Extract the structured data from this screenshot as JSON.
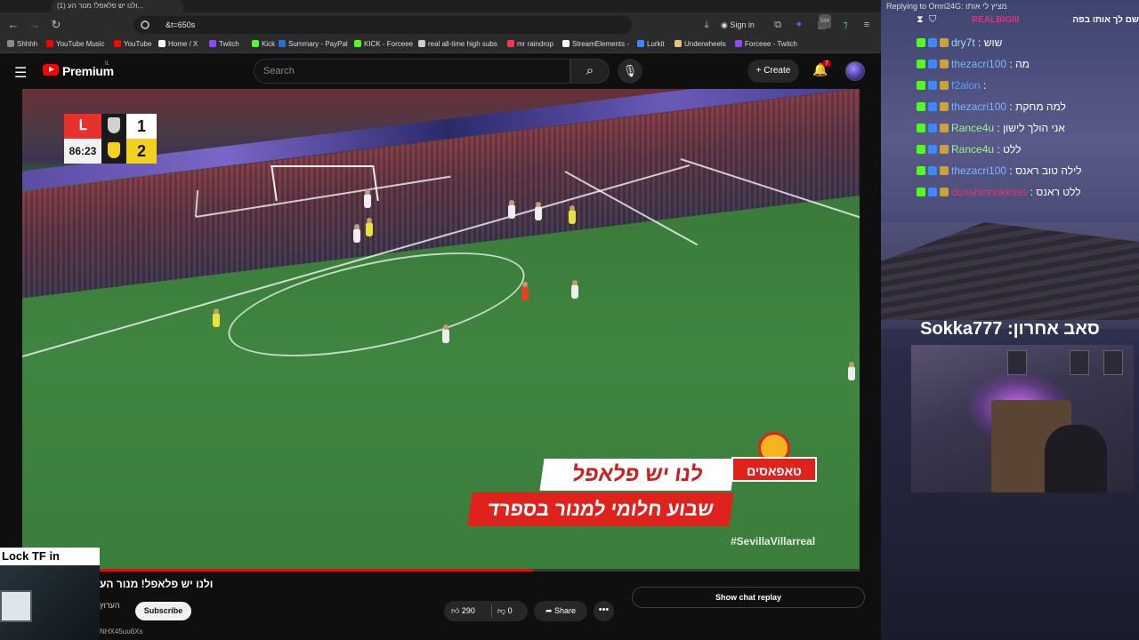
{
  "browser": {
    "tab_title": "(1) ולנו יש פלאפל! מנור הע...",
    "url": "&t=650s",
    "sign_in": "Sign in",
    "extension_count": "584",
    "bookmarks": [
      {
        "label": "Shhhh",
        "color": "#888888"
      },
      {
        "label": "YouTube Music",
        "color": "#ff0000"
      },
      {
        "label": "YouTube",
        "color": "#ff0000"
      },
      {
        "label": "Home / X",
        "color": "#ffffff"
      },
      {
        "label": "Twitch",
        "color": "#9146ff"
      },
      {
        "label": "Kick",
        "color": "#53fc18"
      },
      {
        "label": "Summary - PayPal",
        "color": "#1f6fd6"
      },
      {
        "label": "KICK - Forceee",
        "color": "#53fc18"
      },
      {
        "label": "real all-time high subs",
        "color": "#cccccc"
      },
      {
        "label": "mr raindrop",
        "color": "#ff3355"
      },
      {
        "label": "StreamElements -",
        "color": "#ffffff"
      },
      {
        "label": "Lurkit",
        "color": "#3a8aff"
      },
      {
        "label": "Underwheels",
        "color": "#e8c27a"
      },
      {
        "label": "Forceee - Twitch",
        "color": "#9146ff"
      }
    ]
  },
  "youtube": {
    "logo_text": "Premium",
    "logo_sup": "IL",
    "search_placeholder": "Search",
    "create_label": "Create",
    "notification_count": "7"
  },
  "video": {
    "score": {
      "time": "86:23",
      "home_score": "1",
      "away_score": "2",
      "league_color": "#e8312c",
      "home_crest_color": "#d0d0d0",
      "away_crest_color": "#f2d21c"
    },
    "ad_logo_text": "טאפאסים",
    "ad_line1": "לנו יש פלאפל",
    "ad_line2": "שבוע חלומי למנור בספרד",
    "hashtag": "#SevillaVillarreal",
    "progress_fraction": 0.61
  },
  "below_video": {
    "title": "ולנו יש פלאפל! מנור הע",
    "channel": "הערוץ",
    "subscribe": "Subscribe",
    "likes": "290",
    "dislikes": "0",
    "share": "Share",
    "more": "•••",
    "show_chat_replay": "Show chat replay",
    "url_fragment": "NHX45uu6Xs"
  },
  "overlay": {
    "lock_text": "Lock TF in",
    "reply_to": "Replying to Omri24G: מציץ לי אותו",
    "reply_header_user": "REALBIGIII",
    "reply_header_msg": "שם לך אותו בפה",
    "last_sub": "סאב אחרון: Sokka777",
    "chat": [
      {
        "user": "dry7t",
        "msg": "שוש",
        "color": "#9fd8ff"
      },
      {
        "user": "thezacri100",
        "msg": "מה",
        "color": "#7ab8ff"
      },
      {
        "user": "f2alon",
        "msg": "",
        "color": "#5aa0ff"
      },
      {
        "user": "thezacri100",
        "msg": "למה מחקת",
        "color": "#7ab8ff"
      },
      {
        "user": "Rance4u",
        "msg": "אני הולך לישון",
        "color": "#9cf28a"
      },
      {
        "user": "Rance4u",
        "msg": "ללט",
        "color": "#9cf28a"
      },
      {
        "user": "thezacri100",
        "msg": "לילה טוב ראנס",
        "color": "#7ab8ff"
      },
      {
        "user": "dunshinnokksss",
        "msg": "ללט ראנס",
        "color": "#e0337a"
      }
    ]
  }
}
